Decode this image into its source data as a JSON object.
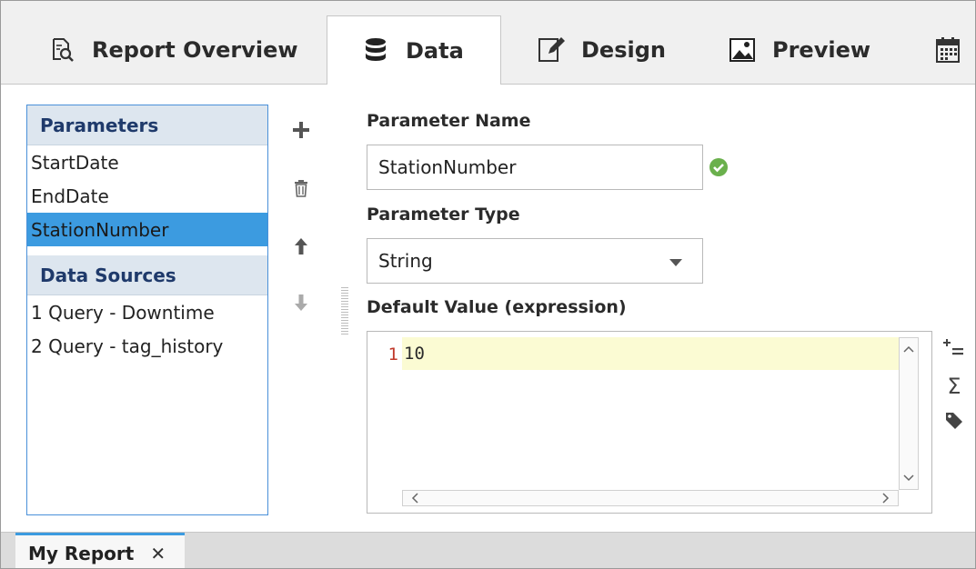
{
  "tabs": [
    {
      "label": "Report Overview",
      "icon": "report-search-icon"
    },
    {
      "label": "Data",
      "icon": "database-icon",
      "active": true
    },
    {
      "label": "Design",
      "icon": "edit-icon"
    },
    {
      "label": "Preview",
      "icon": "image-icon"
    },
    {
      "label": "",
      "icon": "calendar-icon"
    }
  ],
  "left_panel": {
    "parameters_header": "Parameters",
    "parameters": [
      "StartDate",
      "EndDate",
      "StationNumber"
    ],
    "selected_parameter": "StationNumber",
    "data_sources_header": "Data Sources",
    "data_sources": [
      "1 Query - Downtime",
      "2 Query - tag_history"
    ]
  },
  "toolbar": {
    "add": "plus-icon",
    "delete": "trash-icon",
    "move_up": "arrow-up-icon",
    "move_down": "arrow-down-icon"
  },
  "form": {
    "name_label": "Parameter Name",
    "name_value": "StationNumber",
    "type_label": "Parameter Type",
    "type_value": "String",
    "default_label": "Default Value (expression)",
    "line_number": "1",
    "expression": "10"
  },
  "editor_tools": [
    "insert-property-icon",
    "sigma-function-icon",
    "tag-icon"
  ],
  "bottom": {
    "doc_tab": "My Report",
    "close": "✕"
  },
  "colors": {
    "accent": "#3c9be0",
    "header_text": "#1f3a6b",
    "valid": "#6ab04c"
  }
}
